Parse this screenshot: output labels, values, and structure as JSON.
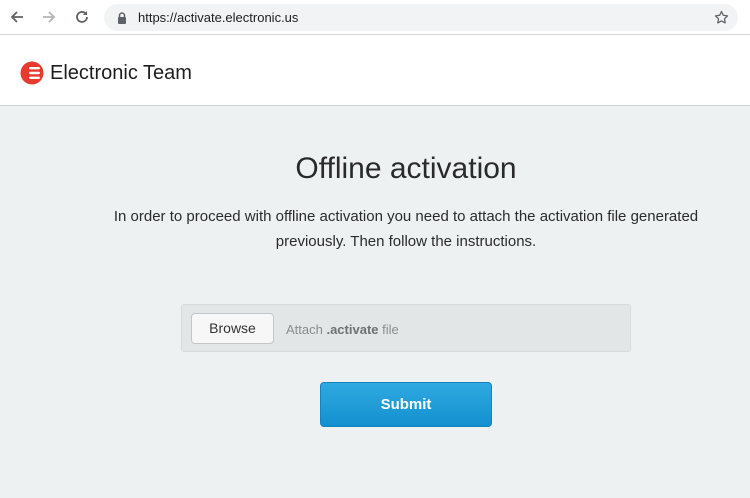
{
  "browser": {
    "url": "https://activate.electronic.us"
  },
  "header": {
    "brand": "Electronic Team",
    "brand_color": "#e63b2e"
  },
  "main": {
    "title": "Offline activation",
    "intro": "In order to proceed with offline activation you need to attach the activation file generated previously. Then follow the instructions.",
    "browse_label": "Browse",
    "file_hint_prefix": "Attach ",
    "file_hint_ext": ".activate",
    "file_hint_suffix": " file",
    "submit_label": "Submit",
    "accent_color": "#1d9bd8"
  }
}
